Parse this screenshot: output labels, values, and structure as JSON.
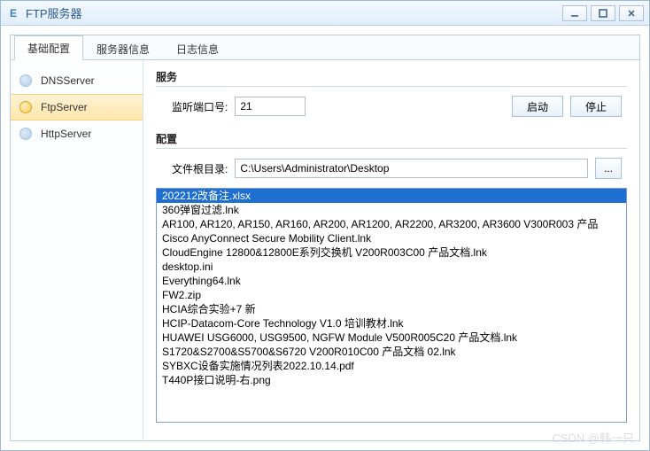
{
  "window": {
    "title": "FTP服务器",
    "icon_letter": "E"
  },
  "tabs": [
    {
      "label": "基础配置",
      "active": true
    },
    {
      "label": "服务器信息",
      "active": false
    },
    {
      "label": "日志信息",
      "active": false
    }
  ],
  "sidebar": {
    "items": [
      {
        "label": "DNSServer",
        "selected": false
      },
      {
        "label": "FtpServer",
        "selected": true
      },
      {
        "label": "HttpServer",
        "selected": false
      }
    ]
  },
  "service": {
    "title": "服务",
    "port_label": "监听端口号:",
    "port_value": "21",
    "start_label": "启动",
    "stop_label": "停止"
  },
  "config": {
    "title": "配置",
    "root_label": "文件根目录:",
    "root_value": "C:\\Users\\Administrator\\Desktop",
    "browse_label": "...",
    "files": [
      {
        "name": "202212改备注.xlsx",
        "selected": true
      },
      {
        "name": "360弹窗过滤.lnk",
        "selected": false
      },
      {
        "name": "AR100, AR120, AR150, AR160, AR200, AR1200, AR2200, AR3200, AR3600 V300R003 产品",
        "selected": false
      },
      {
        "name": "Cisco AnyConnect Secure Mobility Client.lnk",
        "selected": false
      },
      {
        "name": "CloudEngine 12800&12800E系列交换机 V200R003C00 产品文档.lnk",
        "selected": false
      },
      {
        "name": "desktop.ini",
        "selected": false
      },
      {
        "name": "Everything64.lnk",
        "selected": false
      },
      {
        "name": "FW2.zip",
        "selected": false
      },
      {
        "name": "HCIA综合实验+7 新",
        "selected": false
      },
      {
        "name": "HCIP-Datacom-Core Technology V1.0 培训教材.lnk",
        "selected": false
      },
      {
        "name": "HUAWEI USG6000, USG9500, NGFW Module V500R005C20 产品文档.lnk",
        "selected": false
      },
      {
        "name": "S1720&S2700&S5700&S6720 V200R010C00 产品文档 02.lnk",
        "selected": false
      },
      {
        "name": "SYBXC设备实施情况列表2022.10.14.pdf",
        "selected": false
      },
      {
        "name": "T440P接口说明-右.png",
        "selected": false
      }
    ]
  },
  "watermark": "CSDN @韩一只"
}
